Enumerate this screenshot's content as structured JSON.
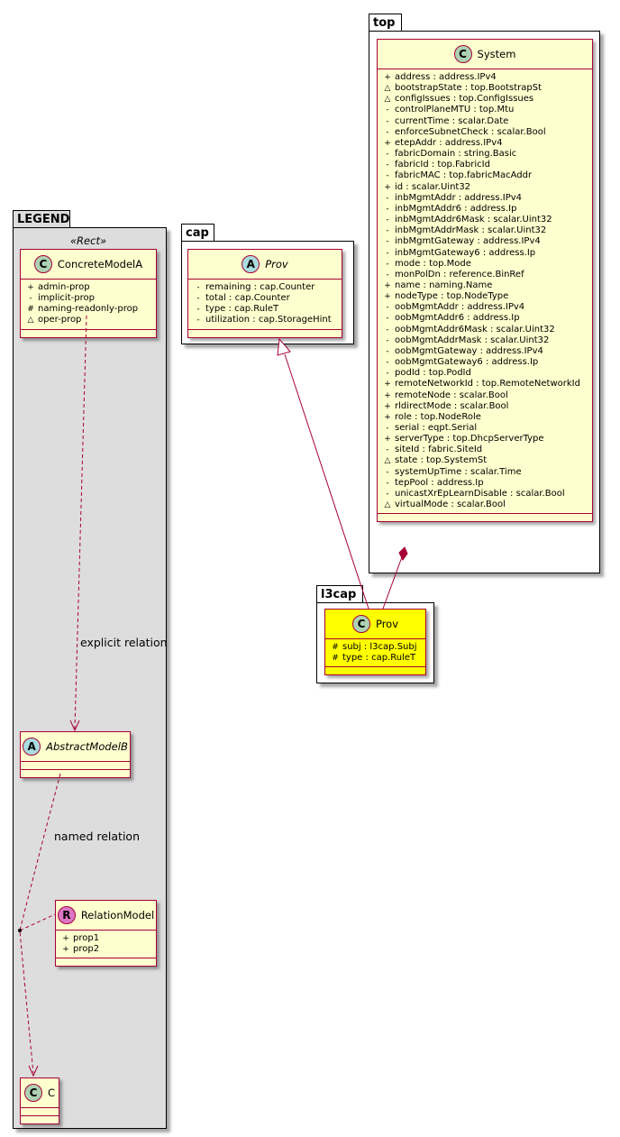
{
  "packages": {
    "top": "top",
    "cap": "cap",
    "l3cap": "l3cap",
    "legend": "LEGEND"
  },
  "system": {
    "name": "System",
    "kind": "C",
    "attributes": [
      {
        "vis": "+",
        "text": "address : address.IPv4"
      },
      {
        "vis": "△",
        "text": "bootstrapState : top.BootstrapSt"
      },
      {
        "vis": "△",
        "text": "configIssues : top.ConfigIssues"
      },
      {
        "vis": "-",
        "text": "controlPlaneMTU : top.Mtu"
      },
      {
        "vis": "-",
        "text": "currentTime : scalar.Date"
      },
      {
        "vis": "-",
        "text": "enforceSubnetCheck : scalar.Bool"
      },
      {
        "vis": "+",
        "text": "etepAddr : address.IPv4"
      },
      {
        "vis": "-",
        "text": "fabricDomain : string.Basic"
      },
      {
        "vis": "-",
        "text": "fabricId : top.FabricId"
      },
      {
        "vis": "-",
        "text": "fabricMAC : top.fabricMacAddr"
      },
      {
        "vis": "+",
        "text": "id : scalar.Uint32"
      },
      {
        "vis": "-",
        "text": "inbMgmtAddr : address.IPv4"
      },
      {
        "vis": "-",
        "text": "inbMgmtAddr6 : address.Ip"
      },
      {
        "vis": "-",
        "text": "inbMgmtAddr6Mask : scalar.Uint32"
      },
      {
        "vis": "-",
        "text": "inbMgmtAddrMask : scalar.Uint32"
      },
      {
        "vis": "-",
        "text": "inbMgmtGateway : address.IPv4"
      },
      {
        "vis": "-",
        "text": "inbMgmtGateway6 : address.Ip"
      },
      {
        "vis": "-",
        "text": "mode : top.Mode"
      },
      {
        "vis": "-",
        "text": "monPolDn : reference.BinRef"
      },
      {
        "vis": "+",
        "text": "name : naming.Name"
      },
      {
        "vis": "+",
        "text": "nodeType : top.NodeType"
      },
      {
        "vis": "-",
        "text": "oobMgmtAddr : address.IPv4"
      },
      {
        "vis": "-",
        "text": "oobMgmtAddr6 : address.Ip"
      },
      {
        "vis": "-",
        "text": "oobMgmtAddr6Mask : scalar.Uint32"
      },
      {
        "vis": "-",
        "text": "oobMgmtAddrMask : scalar.Uint32"
      },
      {
        "vis": "-",
        "text": "oobMgmtGateway : address.IPv4"
      },
      {
        "vis": "-",
        "text": "oobMgmtGateway6 : address.Ip"
      },
      {
        "vis": "-",
        "text": "podId : top.PodId"
      },
      {
        "vis": "+",
        "text": "remoteNetworkId : top.RemoteNetworkId"
      },
      {
        "vis": "+",
        "text": "remoteNode : scalar.Bool"
      },
      {
        "vis": "+",
        "text": "rldirectMode : scalar.Bool"
      },
      {
        "vis": "+",
        "text": "role : top.NodeRole"
      },
      {
        "vis": "-",
        "text": "serial : eqpt.Serial"
      },
      {
        "vis": "+",
        "text": "serverType : top.DhcpServerType"
      },
      {
        "vis": "-",
        "text": "siteId : fabric.SiteId"
      },
      {
        "vis": "△",
        "text": "state : top.SystemSt"
      },
      {
        "vis": "-",
        "text": "systemUpTime : scalar.Time"
      },
      {
        "vis": "-",
        "text": "tepPool : address.Ip"
      },
      {
        "vis": "-",
        "text": "unicastXrEpLearnDisable : scalar.Bool"
      },
      {
        "vis": "△",
        "text": "virtualMode : scalar.Bool"
      }
    ]
  },
  "cap_prov": {
    "name": "Prov",
    "kind": "A",
    "attributes": [
      {
        "vis": "-",
        "text": "remaining : cap.Counter"
      },
      {
        "vis": "-",
        "text": "total : cap.Counter"
      },
      {
        "vis": "-",
        "text": "type : cap.RuleT"
      },
      {
        "vis": "-",
        "text": "utilization : cap.StorageHint"
      }
    ]
  },
  "l3cap_prov": {
    "name": "Prov",
    "kind": "C",
    "attributes": [
      {
        "vis": "#",
        "text": "subj : l3cap.Subj"
      },
      {
        "vis": "#",
        "text": "type : cap.RuleT"
      }
    ]
  },
  "legend": {
    "stereotype": "«Rect»",
    "concrete": {
      "name": "ConcreteModelA",
      "kind": "C",
      "attributes": [
        {
          "vis": "+",
          "text": "admin-prop"
        },
        {
          "vis": "-",
          "text": "implicit-prop"
        },
        {
          "vis": "#",
          "text": "naming-readonly-prop"
        },
        {
          "vis": "△",
          "text": "oper-prop"
        }
      ]
    },
    "abstract": {
      "name": "AbstractModelB",
      "kind": "A"
    },
    "relation_model": {
      "name": "RelationModel",
      "kind": "R",
      "attributes": [
        {
          "vis": "+",
          "text": "prop1"
        },
        {
          "vis": "+",
          "text": "prop2"
        }
      ]
    },
    "c": {
      "name": "C",
      "kind": "C"
    },
    "explicit_label": "explicit relation",
    "named_label": "named relation"
  },
  "colors": {
    "class_fill": "#fefece",
    "class_border": "#a80036",
    "highlight_fill": "#ffff00",
    "legend_fill": "#dddddd"
  }
}
